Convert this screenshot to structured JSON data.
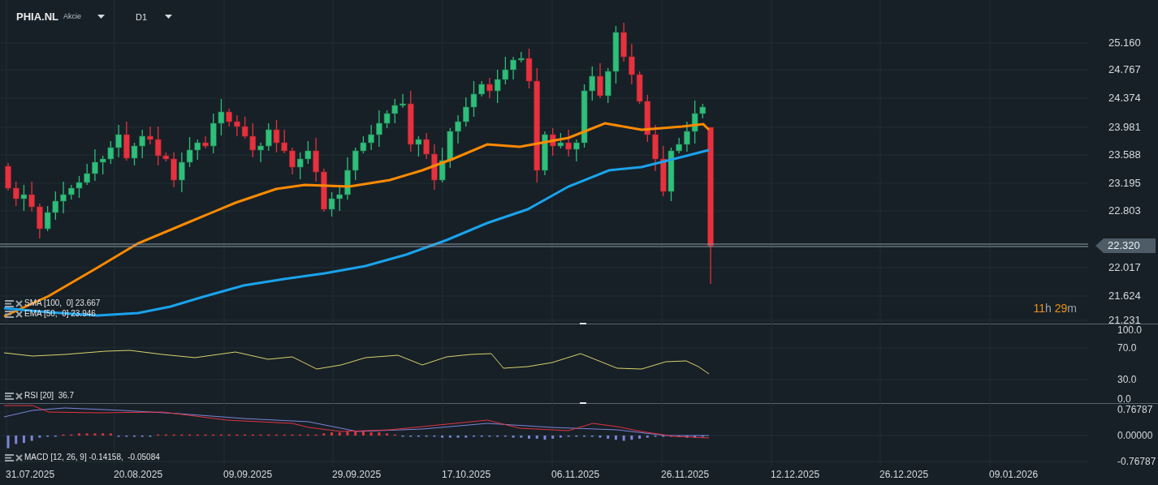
{
  "header": {
    "symbol": "PHIA.NL",
    "instrument_type": "Akcie",
    "timeframe": "D1"
  },
  "price_panel": {
    "indicators": [
      {
        "label": "SMA [100,  0] 23.667",
        "color": "#1aa3ec"
      },
      {
        "label": "EMA [50,  0] 23.946",
        "color": "#ff8a00"
      }
    ],
    "axis": [
      "25.160",
      "24.767",
      "24.374",
      "23.981",
      "23.588",
      "23.195",
      "22.803",
      "22.017",
      "21.624",
      "21.231"
    ],
    "last_price": "22.320",
    "countdown": {
      "hours": "11",
      "hours_unit": "h",
      "minutes": "29",
      "minutes_unit": "m"
    }
  },
  "rsi_panel": {
    "legend": "RSI [20]  36.7",
    "axis": [
      "100.0",
      "70.0",
      "30.0",
      "0.0"
    ]
  },
  "macd_panel": {
    "legend": "MACD [12, 26, 9] -0.14158,  -0.05084",
    "axis": [
      "0.76787",
      "0.00000",
      "-0.76787"
    ]
  },
  "date_axis": [
    "31.07.2025",
    "20.08.2025",
    "09.09.2025",
    "29.09.2025",
    "17.10.2025",
    "06.11.2025",
    "26.11.2025",
    "12.12.2025",
    "26.12.2025",
    "09.01.2026"
  ]
}
